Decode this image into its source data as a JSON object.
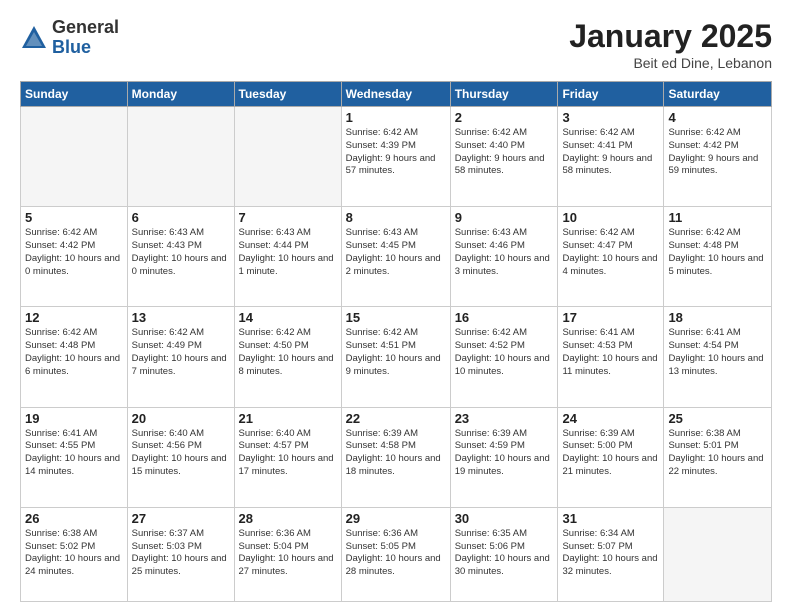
{
  "header": {
    "logo_general": "General",
    "logo_blue": "Blue",
    "title": "January 2025",
    "subtitle": "Beit ed Dine, Lebanon"
  },
  "columns": [
    "Sunday",
    "Monday",
    "Tuesday",
    "Wednesday",
    "Thursday",
    "Friday",
    "Saturday"
  ],
  "weeks": [
    [
      {
        "day": "",
        "info": ""
      },
      {
        "day": "",
        "info": ""
      },
      {
        "day": "",
        "info": ""
      },
      {
        "day": "1",
        "info": "Sunrise: 6:42 AM\nSunset: 4:39 PM\nDaylight: 9 hours and 57 minutes."
      },
      {
        "day": "2",
        "info": "Sunrise: 6:42 AM\nSunset: 4:40 PM\nDaylight: 9 hours and 58 minutes."
      },
      {
        "day": "3",
        "info": "Sunrise: 6:42 AM\nSunset: 4:41 PM\nDaylight: 9 hours and 58 minutes."
      },
      {
        "day": "4",
        "info": "Sunrise: 6:42 AM\nSunset: 4:42 PM\nDaylight: 9 hours and 59 minutes."
      }
    ],
    [
      {
        "day": "5",
        "info": "Sunrise: 6:42 AM\nSunset: 4:42 PM\nDaylight: 10 hours and 0 minutes."
      },
      {
        "day": "6",
        "info": "Sunrise: 6:43 AM\nSunset: 4:43 PM\nDaylight: 10 hours and 0 minutes."
      },
      {
        "day": "7",
        "info": "Sunrise: 6:43 AM\nSunset: 4:44 PM\nDaylight: 10 hours and 1 minute."
      },
      {
        "day": "8",
        "info": "Sunrise: 6:43 AM\nSunset: 4:45 PM\nDaylight: 10 hours and 2 minutes."
      },
      {
        "day": "9",
        "info": "Sunrise: 6:43 AM\nSunset: 4:46 PM\nDaylight: 10 hours and 3 minutes."
      },
      {
        "day": "10",
        "info": "Sunrise: 6:42 AM\nSunset: 4:47 PM\nDaylight: 10 hours and 4 minutes."
      },
      {
        "day": "11",
        "info": "Sunrise: 6:42 AM\nSunset: 4:48 PM\nDaylight: 10 hours and 5 minutes."
      }
    ],
    [
      {
        "day": "12",
        "info": "Sunrise: 6:42 AM\nSunset: 4:48 PM\nDaylight: 10 hours and 6 minutes."
      },
      {
        "day": "13",
        "info": "Sunrise: 6:42 AM\nSunset: 4:49 PM\nDaylight: 10 hours and 7 minutes."
      },
      {
        "day": "14",
        "info": "Sunrise: 6:42 AM\nSunset: 4:50 PM\nDaylight: 10 hours and 8 minutes."
      },
      {
        "day": "15",
        "info": "Sunrise: 6:42 AM\nSunset: 4:51 PM\nDaylight: 10 hours and 9 minutes."
      },
      {
        "day": "16",
        "info": "Sunrise: 6:42 AM\nSunset: 4:52 PM\nDaylight: 10 hours and 10 minutes."
      },
      {
        "day": "17",
        "info": "Sunrise: 6:41 AM\nSunset: 4:53 PM\nDaylight: 10 hours and 11 minutes."
      },
      {
        "day": "18",
        "info": "Sunrise: 6:41 AM\nSunset: 4:54 PM\nDaylight: 10 hours and 13 minutes."
      }
    ],
    [
      {
        "day": "19",
        "info": "Sunrise: 6:41 AM\nSunset: 4:55 PM\nDaylight: 10 hours and 14 minutes."
      },
      {
        "day": "20",
        "info": "Sunrise: 6:40 AM\nSunset: 4:56 PM\nDaylight: 10 hours and 15 minutes."
      },
      {
        "day": "21",
        "info": "Sunrise: 6:40 AM\nSunset: 4:57 PM\nDaylight: 10 hours and 17 minutes."
      },
      {
        "day": "22",
        "info": "Sunrise: 6:39 AM\nSunset: 4:58 PM\nDaylight: 10 hours and 18 minutes."
      },
      {
        "day": "23",
        "info": "Sunrise: 6:39 AM\nSunset: 4:59 PM\nDaylight: 10 hours and 19 minutes."
      },
      {
        "day": "24",
        "info": "Sunrise: 6:39 AM\nSunset: 5:00 PM\nDaylight: 10 hours and 21 minutes."
      },
      {
        "day": "25",
        "info": "Sunrise: 6:38 AM\nSunset: 5:01 PM\nDaylight: 10 hours and 22 minutes."
      }
    ],
    [
      {
        "day": "26",
        "info": "Sunrise: 6:38 AM\nSunset: 5:02 PM\nDaylight: 10 hours and 24 minutes."
      },
      {
        "day": "27",
        "info": "Sunrise: 6:37 AM\nSunset: 5:03 PM\nDaylight: 10 hours and 25 minutes."
      },
      {
        "day": "28",
        "info": "Sunrise: 6:36 AM\nSunset: 5:04 PM\nDaylight: 10 hours and 27 minutes."
      },
      {
        "day": "29",
        "info": "Sunrise: 6:36 AM\nSunset: 5:05 PM\nDaylight: 10 hours and 28 minutes."
      },
      {
        "day": "30",
        "info": "Sunrise: 6:35 AM\nSunset: 5:06 PM\nDaylight: 10 hours and 30 minutes."
      },
      {
        "day": "31",
        "info": "Sunrise: 6:34 AM\nSunset: 5:07 PM\nDaylight: 10 hours and 32 minutes."
      },
      {
        "day": "",
        "info": ""
      }
    ]
  ]
}
